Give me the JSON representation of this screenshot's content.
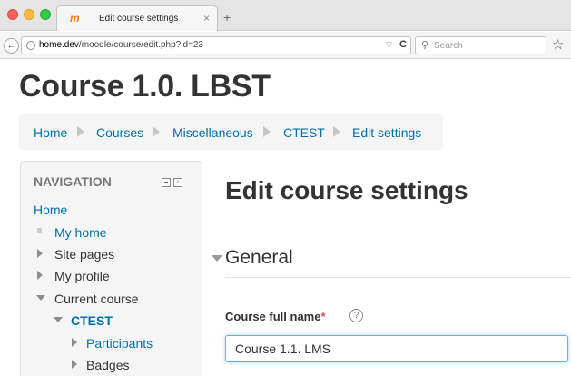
{
  "browser": {
    "tab_title": "Edit course settings",
    "tab_favicon": "m",
    "tab_close": "×",
    "new_tab": "+",
    "url_host": "home.dev",
    "url_path": "/moodle/course/edit.php?id=23",
    "search_placeholder": "Search",
    "icons": {
      "back": "back-arrow-icon",
      "site": "globe-icon",
      "reload": "reload-icon",
      "search": "search-icon",
      "bookmark": "bookmark-star-icon"
    }
  },
  "page": {
    "heading": "Course 1.0. LBST",
    "breadcrumb": [
      "Home",
      "Courses",
      "Miscellaneous",
      "CTEST",
      "Edit settings"
    ]
  },
  "navigation": {
    "title": "NAVIGATION",
    "home": "Home",
    "items": {
      "my_home": "My home",
      "site_pages": "Site pages",
      "my_profile": "My profile",
      "current_course": "Current course",
      "course": "CTEST",
      "participants": "Participants",
      "badges": "Badges"
    }
  },
  "main": {
    "title": "Edit course settings",
    "section": "General",
    "fullname_label": "Course full name",
    "required_marker": "*",
    "help_marker": "?",
    "fullname_value": "Course 1.1. LMS"
  },
  "colors": {
    "link": "#0070a8",
    "required": "#d9534f",
    "focus": "#66afe9"
  }
}
